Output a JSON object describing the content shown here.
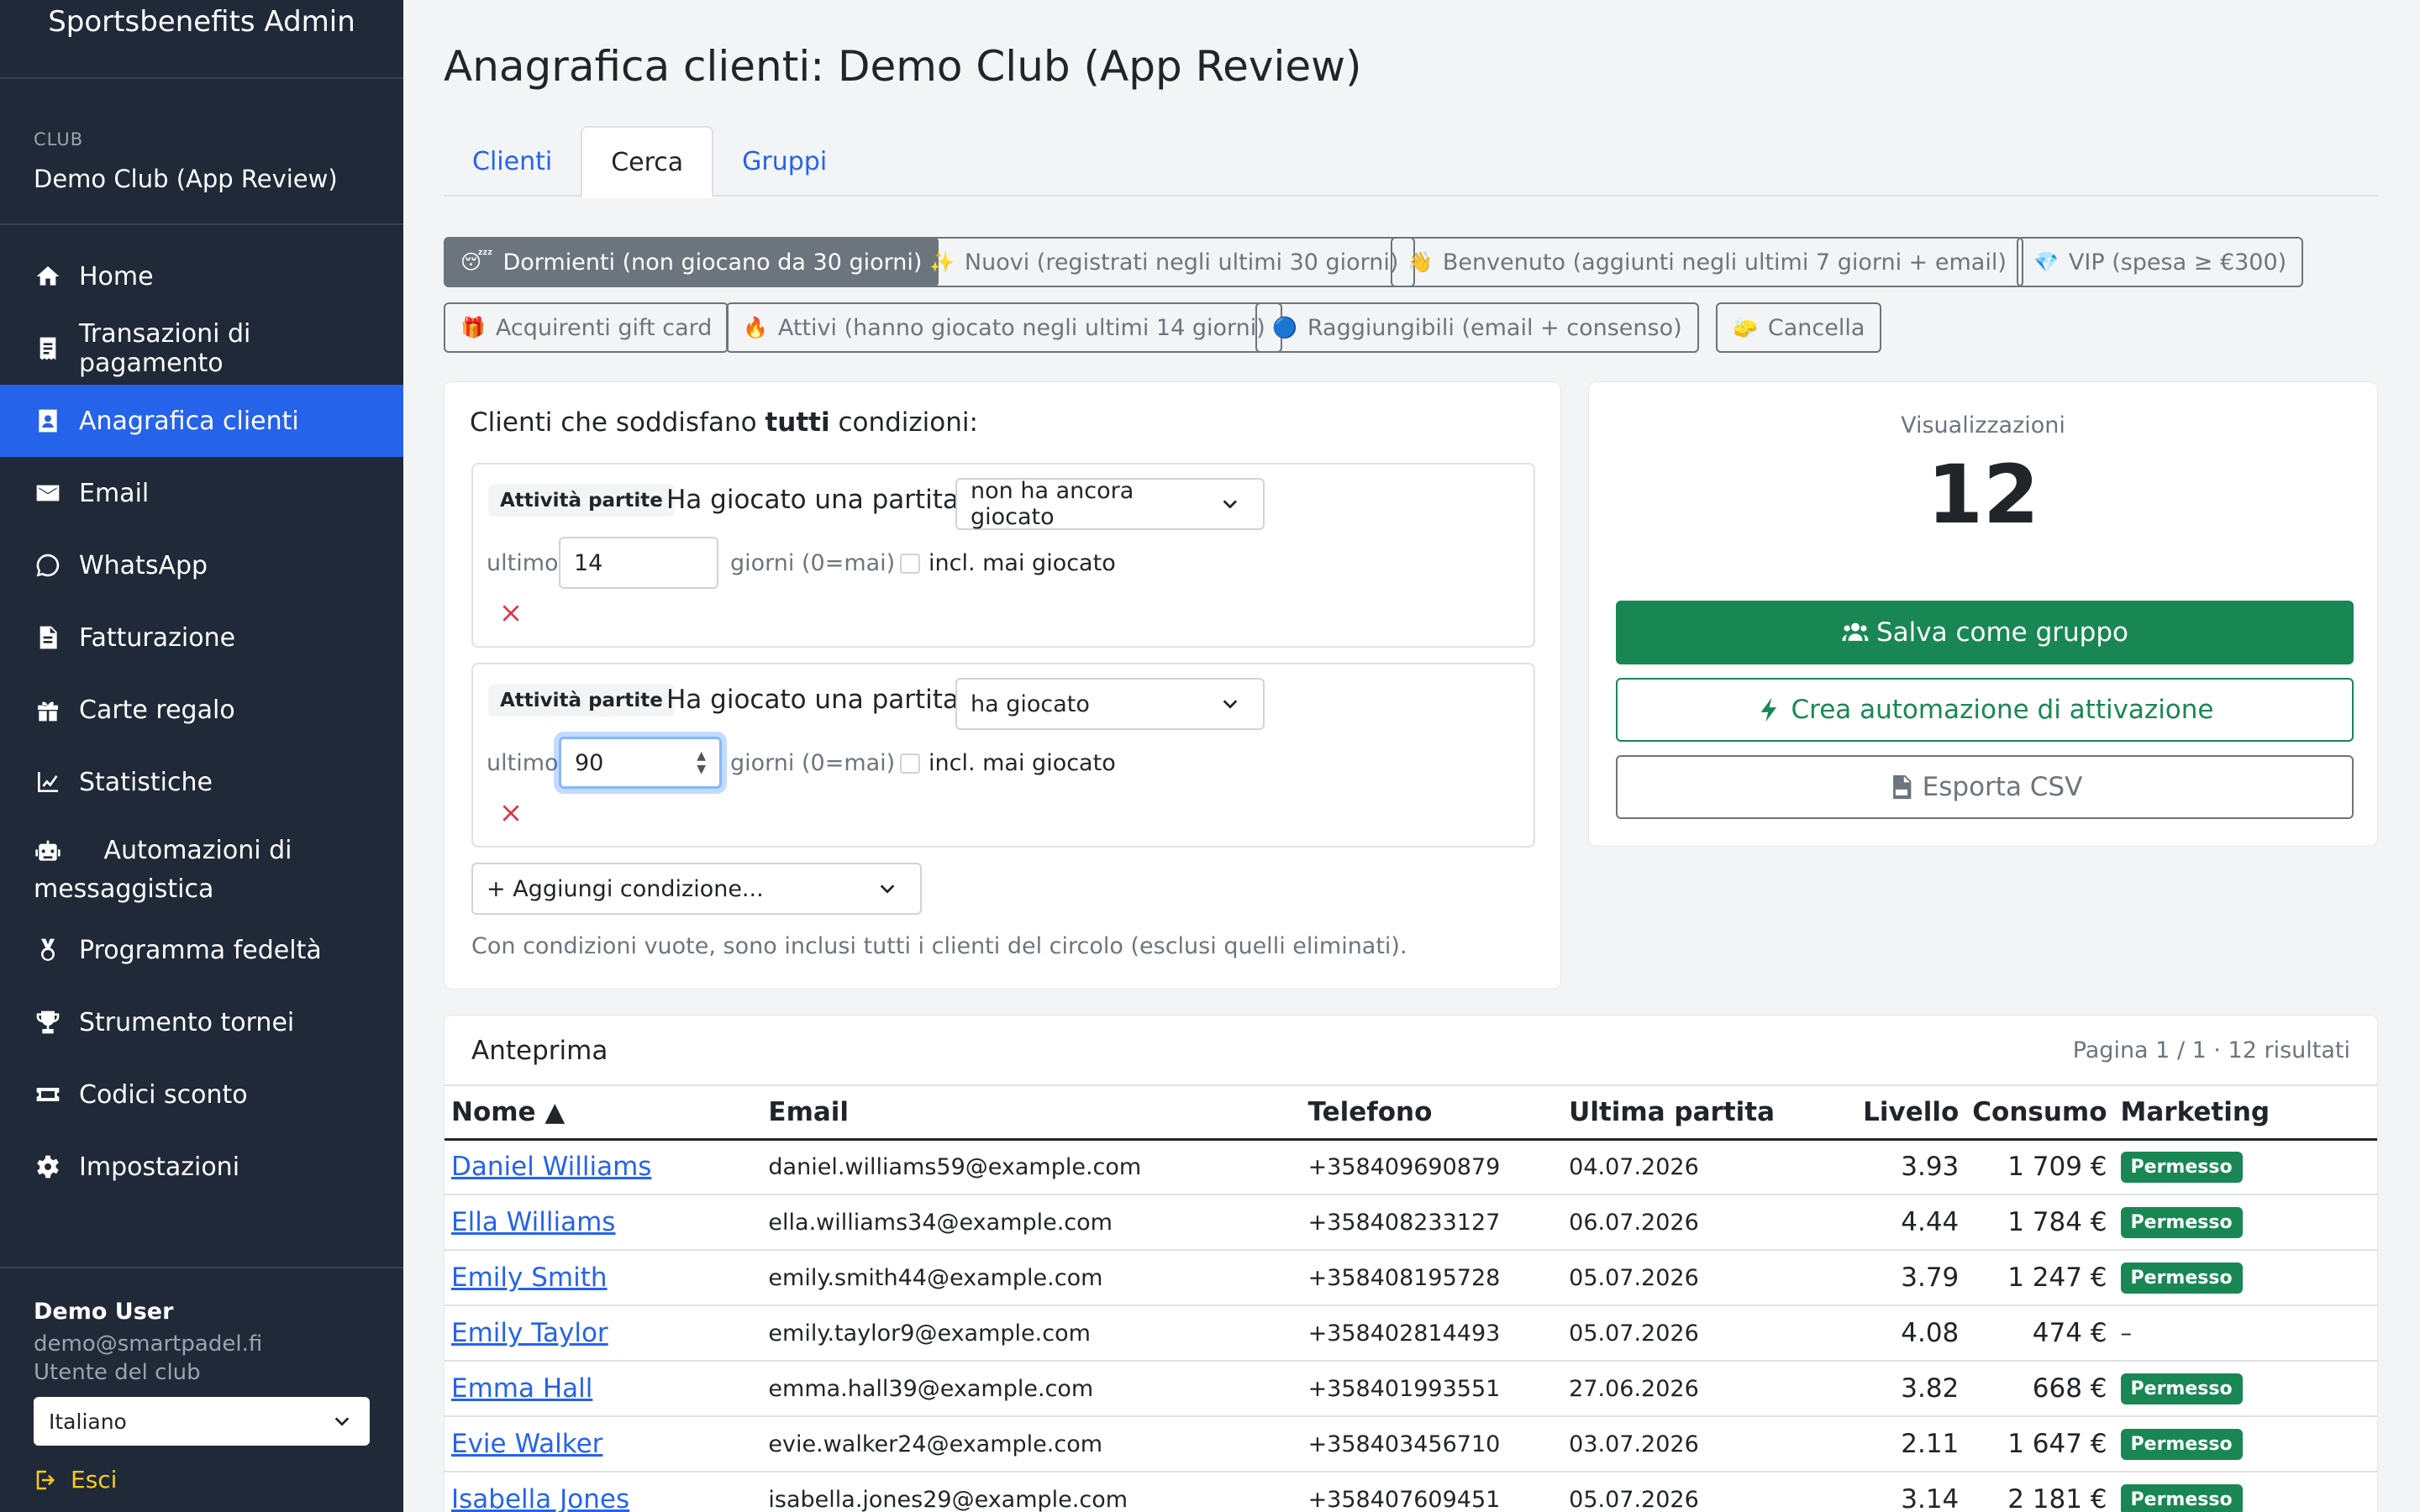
{
  "app": {
    "title": "Sportsbenefits Admin"
  },
  "club": {
    "caption": "CLUB",
    "name": "Demo Club (App Review)"
  },
  "nav": [
    {
      "label": "Home",
      "icon": "home-icon"
    },
    {
      "label": "Transazioni di pagamento",
      "icon": "receipt-icon"
    },
    {
      "label": "Anagrafica clienti",
      "icon": "contact-card-icon",
      "active": true
    },
    {
      "label": "Email",
      "icon": "envelope-icon"
    },
    {
      "label": "WhatsApp",
      "icon": "whatsapp-icon"
    },
    {
      "label": "Fatturazione",
      "icon": "invoice-icon"
    },
    {
      "label": "Carte regalo",
      "icon": "gift-icon"
    },
    {
      "label": "Statistiche",
      "icon": "line-chart-icon"
    },
    {
      "label": "Automazioni di messaggistica",
      "icon": "robot-icon"
    },
    {
      "label": "Programma fedeltà",
      "icon": "medal-icon"
    },
    {
      "label": "Strumento tornei",
      "icon": "trophy-icon"
    },
    {
      "label": "Codici sconto",
      "icon": "ticket-icon"
    },
    {
      "label": "Impostazioni",
      "icon": "gear-icon"
    }
  ],
  "user": {
    "name": "Demo User",
    "email": "demo@smartpadel.fi",
    "role": "Utente del club",
    "language": "Italiano",
    "logout": "Esci"
  },
  "page": {
    "title": "Anagrafica clienti: Demo Club (App Review)"
  },
  "tabs": [
    "Clienti",
    "Cerca",
    "Gruppi"
  ],
  "active_tab": "Cerca",
  "presets": [
    {
      "emoji": "😴",
      "label": "Dormienti (non giocano da 30 giorni)",
      "active": true
    },
    {
      "emoji": "✨",
      "label": "Nuovi (registrati negli ultimi 30 giorni)"
    },
    {
      "emoji": "👋",
      "label": "Benvenuto (aggiunti negli ultimi 7 giorni + email)"
    },
    {
      "emoji": "💎",
      "label": "VIP (spesa ≥ €300)"
    },
    {
      "emoji": "🎁",
      "label": "Acquirenti gift card"
    },
    {
      "emoji": "🔥",
      "label": "Attivi (hanno giocato negli ultimi 14 giorni)"
    },
    {
      "emoji": "🔵",
      "label": "Raggiungibili (email + consenso)"
    },
    {
      "emoji": "🧽",
      "label": "Cancella"
    }
  ],
  "conditions": {
    "title_prefix": "Clienti che soddisfano ",
    "title_bold": "tutti",
    "title_suffix": " condizioni:",
    "rows": [
      {
        "badge": "Attività partite",
        "label": "Ha giocato una partita",
        "select": "non ha ancora giocato",
        "prefix": "ultimo",
        "days": "14",
        "suffix": "giorni (0=mai)",
        "checkbox_label": "incl. mai giocato"
      },
      {
        "badge": "Attività partite",
        "label": "Ha giocato una partita",
        "select": "ha giocato",
        "prefix": "ultimo",
        "days": "90",
        "suffix": "giorni (0=mai)",
        "checkbox_label": "incl. mai giocato"
      }
    ],
    "add_label": "+ Aggiungi condizione...",
    "note": "Con condizioni vuote, sono inclusi tutti i clienti del circolo (esclusi quelli eliminati)."
  },
  "stats": {
    "views_label": "Visualizzazioni",
    "views_count": "12",
    "save_group": "Salva come gruppo",
    "create_automation": "Crea automazione di attivazione",
    "export_csv": "Esporta CSV"
  },
  "preview": {
    "title": "Anteprima",
    "pagination": "Pagina 1 / 1 · 12 risultati",
    "columns": [
      "Nome ▲",
      "Email",
      "Telefono",
      "Ultima partita",
      "Livello",
      "Consumo",
      "Marketing"
    ],
    "rows": [
      {
        "name": "Daniel Williams",
        "email": "daniel.williams59@example.com",
        "phone": "+358409690879",
        "last": "04.07.2026",
        "level": "3.93",
        "spend": "1 709 €",
        "marketing": "Permesso"
      },
      {
        "name": "Ella Williams",
        "email": "ella.williams34@example.com",
        "phone": "+358408233127",
        "last": "06.07.2026",
        "level": "4.44",
        "spend": "1 784 €",
        "marketing": "Permesso"
      },
      {
        "name": "Emily Smith",
        "email": "emily.smith44@example.com",
        "phone": "+358408195728",
        "last": "05.07.2026",
        "level": "3.79",
        "spend": "1 247 €",
        "marketing": "Permesso"
      },
      {
        "name": "Emily Taylor",
        "email": "emily.taylor9@example.com",
        "phone": "+358402814493",
        "last": "05.07.2026",
        "level": "4.08",
        "spend": "474 €",
        "marketing": "–"
      },
      {
        "name": "Emma Hall",
        "email": "emma.hall39@example.com",
        "phone": "+358401993551",
        "last": "27.06.2026",
        "level": "3.82",
        "spend": "668 €",
        "marketing": "Permesso"
      },
      {
        "name": "Evie Walker",
        "email": "evie.walker24@example.com",
        "phone": "+358403456710",
        "last": "03.07.2026",
        "level": "2.11",
        "spend": "1 647 €",
        "marketing": "Permesso"
      },
      {
        "name": "Isabella Jones",
        "email": "isabella.jones29@example.com",
        "phone": "+358407609451",
        "last": "05.07.2026",
        "level": "3.14",
        "spend": "2 181 €",
        "marketing": "Permesso"
      }
    ]
  },
  "colors": {
    "sidebar": "#1f2937",
    "active": "#2563eb",
    "success": "#198754",
    "secondary": "#6c757d"
  }
}
